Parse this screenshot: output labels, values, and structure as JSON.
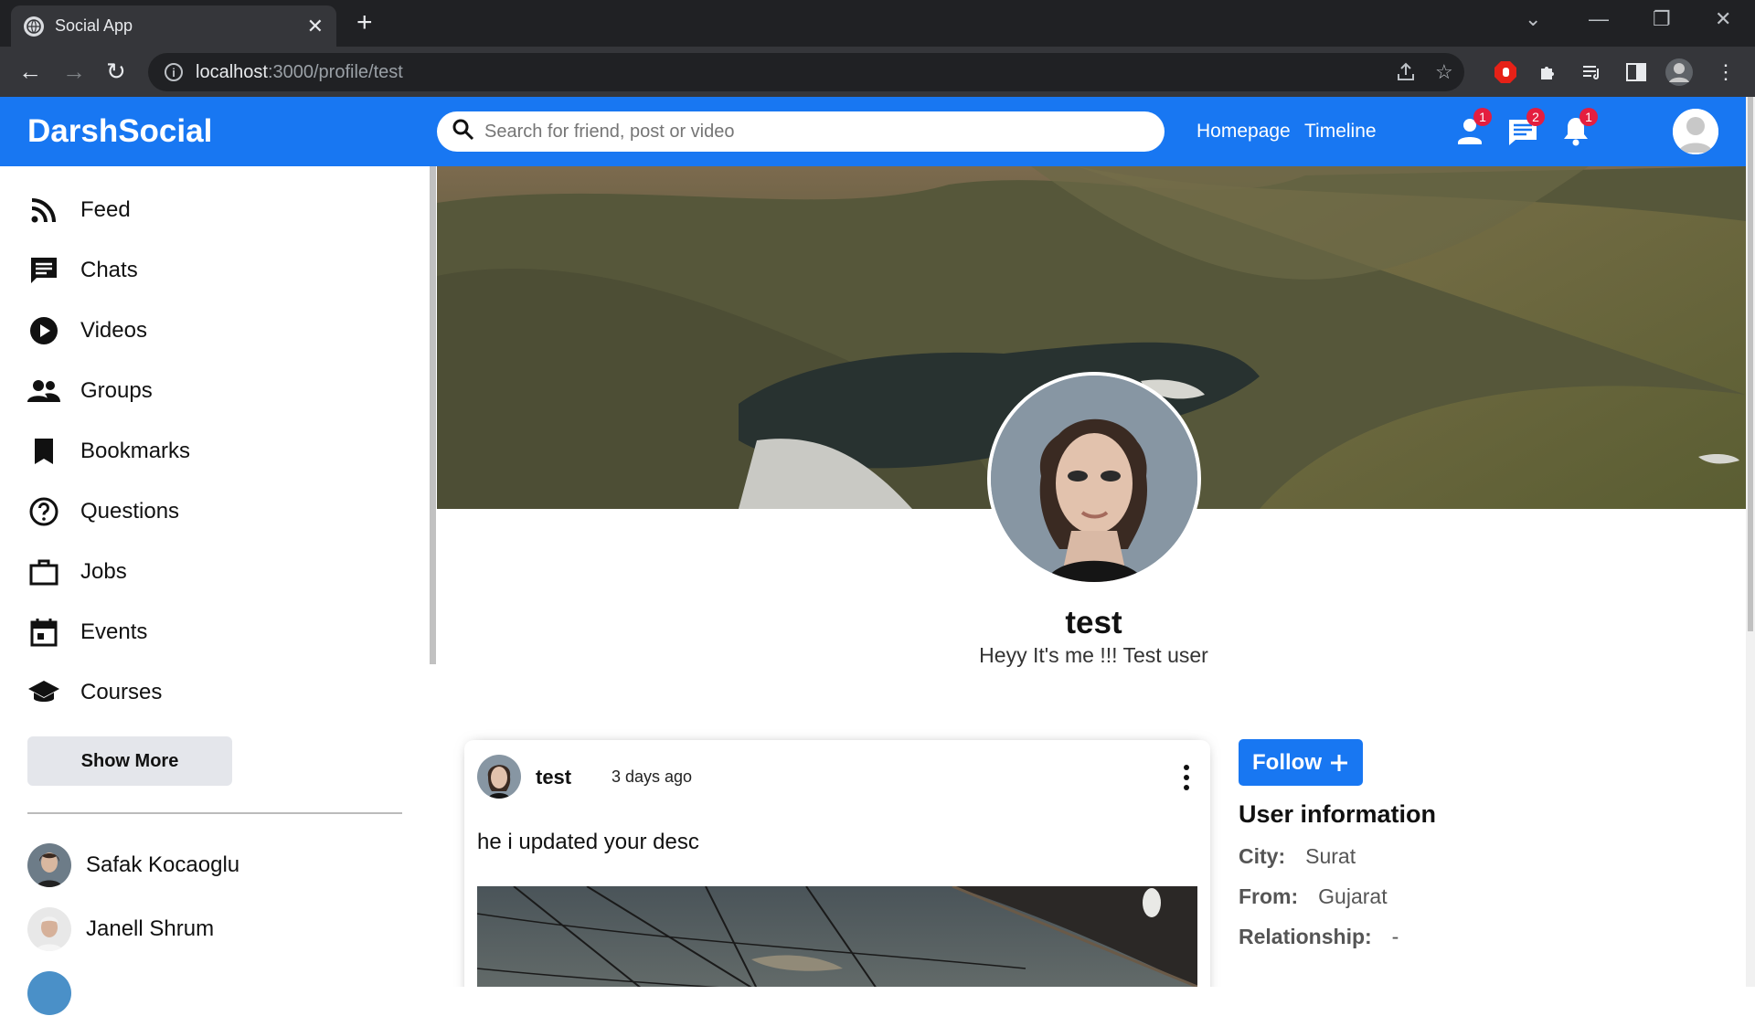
{
  "browser": {
    "tab_title": "Social App",
    "url_host": "localhost",
    "url_path": ":3000/profile/test"
  },
  "app": {
    "logo": "DarshSocial",
    "search_placeholder": "Search for friend, post or video",
    "links": [
      "Homepage",
      "Timeline"
    ],
    "badges": {
      "friends": "1",
      "messages": "2",
      "notifications": "1"
    },
    "brand_color": "#1877f2"
  },
  "sidebar": {
    "items": [
      {
        "label": "Feed",
        "icon": "rss-feed-icon"
      },
      {
        "label": "Chats",
        "icon": "chat-icon"
      },
      {
        "label": "Videos",
        "icon": "play-circle-icon"
      },
      {
        "label": "Groups",
        "icon": "group-icon"
      },
      {
        "label": "Bookmarks",
        "icon": "bookmark-icon"
      },
      {
        "label": "Questions",
        "icon": "help-circle-icon"
      },
      {
        "label": "Jobs",
        "icon": "briefcase-icon"
      },
      {
        "label": "Events",
        "icon": "calendar-icon"
      },
      {
        "label": "Courses",
        "icon": "school-icon"
      }
    ],
    "show_more": "Show More",
    "friends": [
      {
        "name": "Safak Kocaoglu"
      },
      {
        "name": "Janell Shrum"
      }
    ]
  },
  "profile": {
    "name": "test",
    "description": "Heyy It's me !!! Test user"
  },
  "post": {
    "username": "test",
    "date": "3 days ago",
    "text": "he i updated your desc"
  },
  "rightbar": {
    "follow_label": "Follow",
    "info_title": "User information",
    "info": [
      {
        "key": "City:",
        "value": "Surat"
      },
      {
        "key": "From:",
        "value": "Gujarat"
      },
      {
        "key": "Relationship:",
        "value": "-"
      }
    ]
  }
}
